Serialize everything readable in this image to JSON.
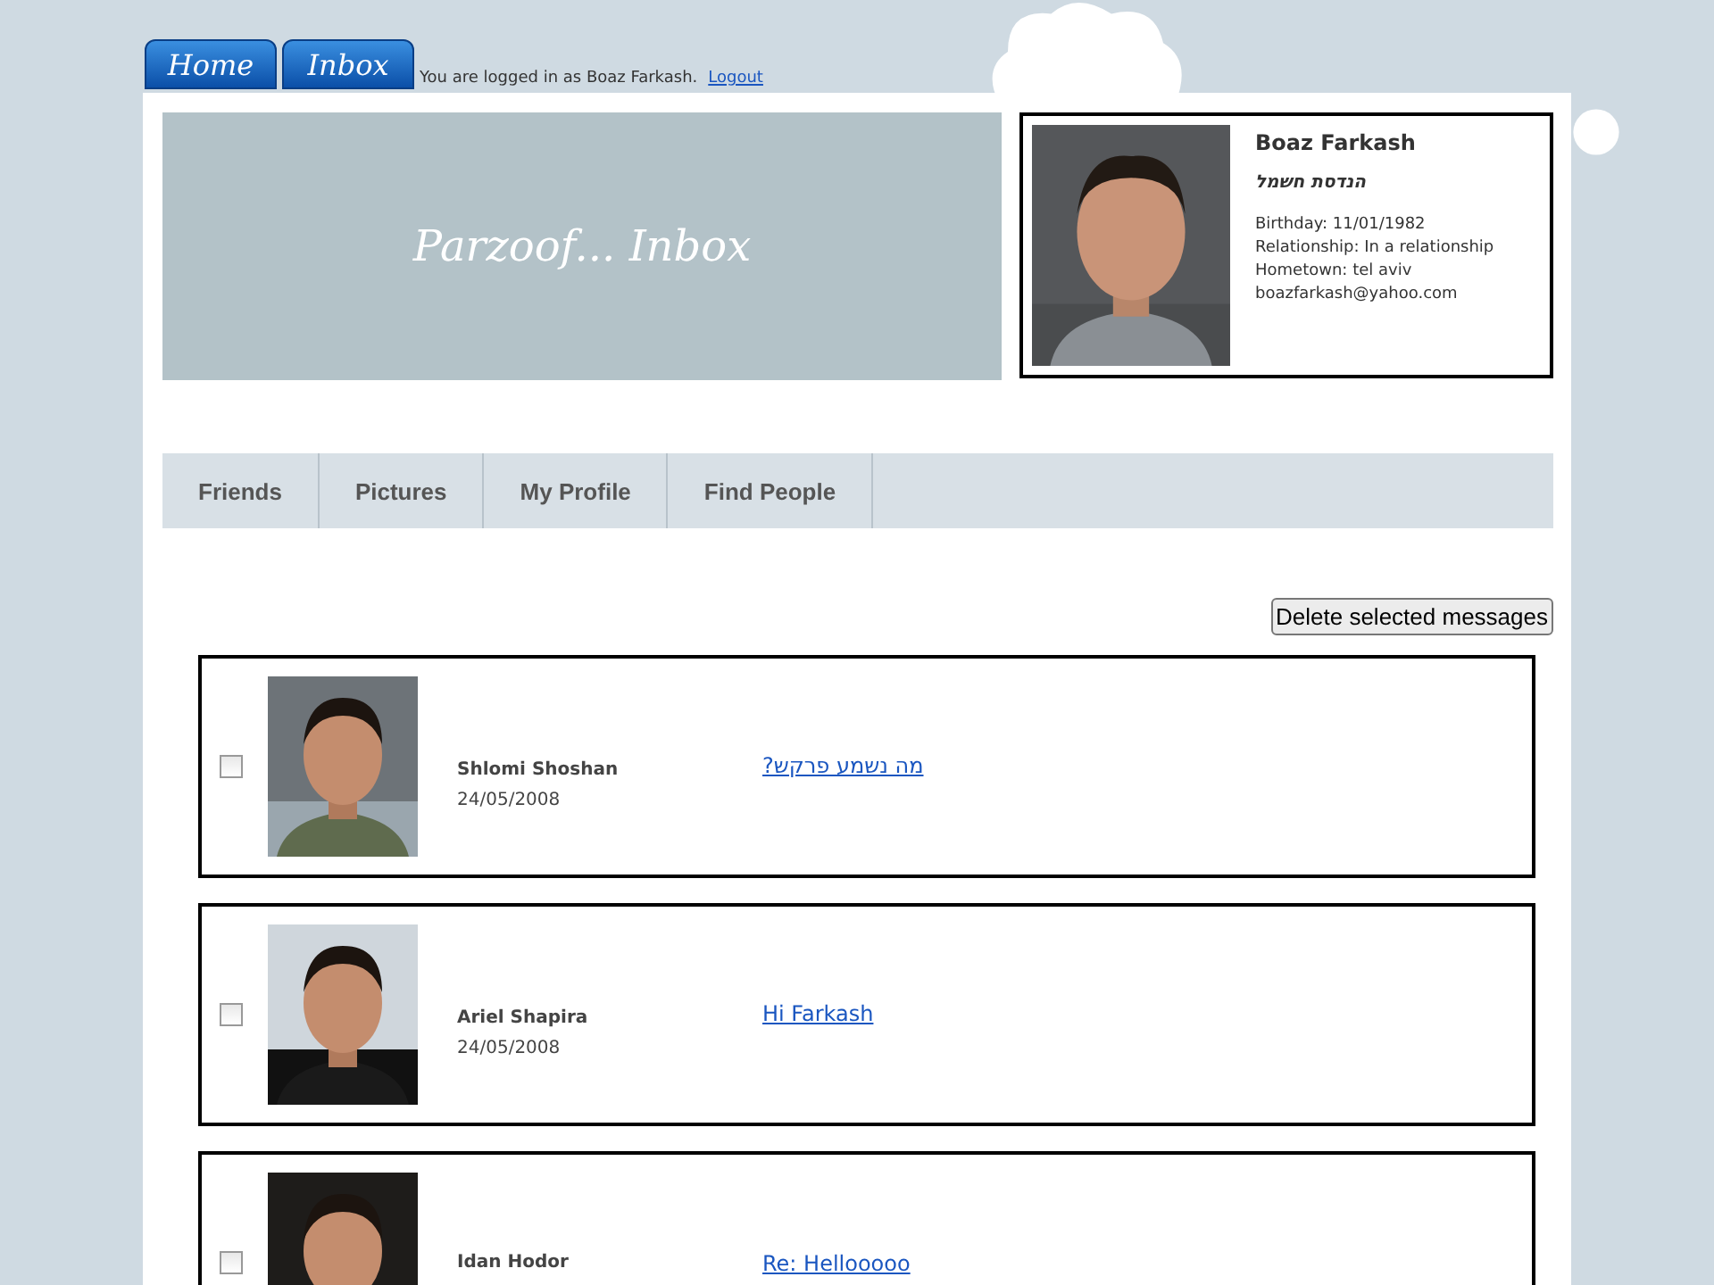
{
  "top_tabs": [
    {
      "label": "Home"
    },
    {
      "label": "Inbox"
    }
  ],
  "login": {
    "text": "You are logged in as Boaz Farkash.",
    "link": "Logout"
  },
  "banner": {
    "title": "Parzoof... Inbox"
  },
  "profile": {
    "name": "Boaz Farkash",
    "subtitle": "הנדסת חשמל",
    "details": [
      "Birthday: 11/01/1982",
      "Relationship: In a relationship",
      "Hometown: tel aviv",
      "boazfarkash@yahoo.com"
    ]
  },
  "nav": [
    {
      "label": "Friends"
    },
    {
      "label": "Pictures"
    },
    {
      "label": "My Profile"
    },
    {
      "label": "Find People"
    }
  ],
  "delete_button": "Delete selected messages",
  "messages": [
    {
      "checked": false,
      "sender": "Shlomi Shoshan",
      "date": "24/05/2008",
      "subject": "מה נשמע פרקש?"
    },
    {
      "checked": false,
      "sender": "Ariel Shapira",
      "date": "24/05/2008",
      "subject": "Hi Farkash"
    },
    {
      "checked": false,
      "sender": "Idan Hodor",
      "subject": "Re: Hellooooo"
    }
  ]
}
